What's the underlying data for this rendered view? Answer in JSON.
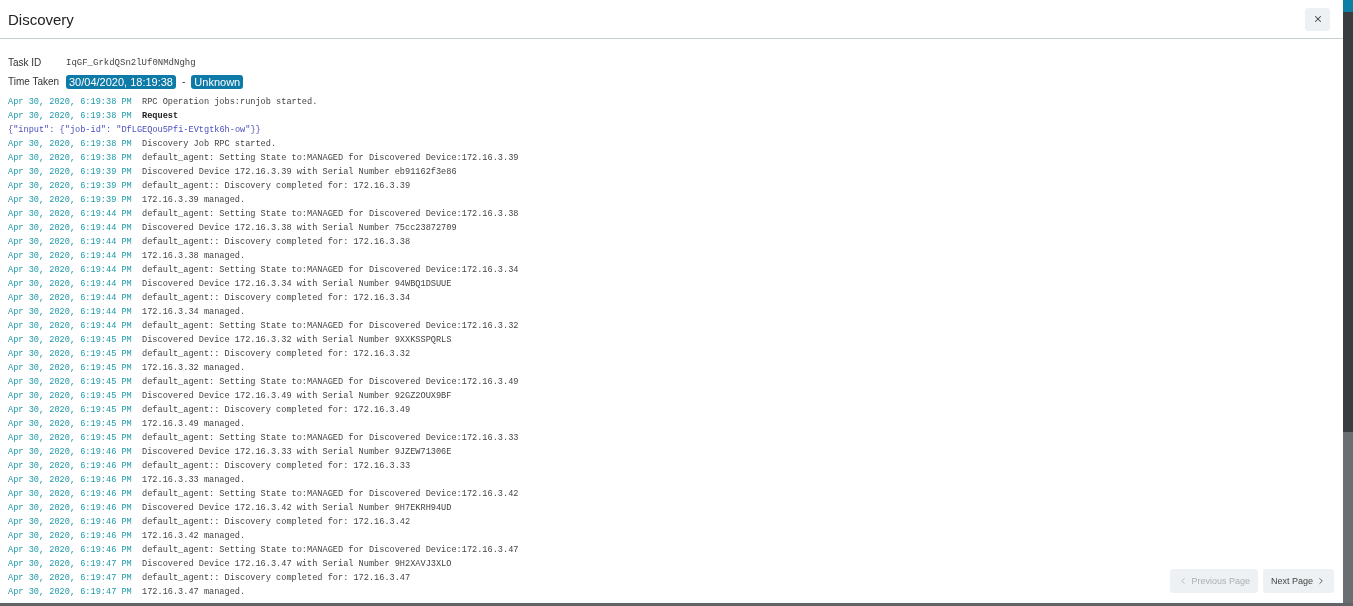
{
  "dialog": {
    "title": "Discovery"
  },
  "task": {
    "label": "Task ID",
    "value": "IqGF_GrkdQSn2lUf0NMdNghg"
  },
  "time_taken": {
    "label": "Time Taken",
    "start": "30/04/2020, 18:19:38",
    "separator": "-",
    "end": "Unknown"
  },
  "log": [
    {
      "kind": "entry",
      "time": "Apr 30, 2020, 6:19:38 PM",
      "message": "RPC Operation jobs:runjob started."
    },
    {
      "kind": "request",
      "time": "Apr 30, 2020, 6:19:38 PM",
      "message": "Request"
    },
    {
      "kind": "json",
      "message": "{\"input\": {\"job-id\": \"DfLGEQou5Pfi-EVtgtk6h-ow\"}}"
    },
    {
      "kind": "entry",
      "time": "Apr 30, 2020, 6:19:38 PM",
      "message": "Discovery Job RPC started."
    },
    {
      "kind": "entry",
      "time": "Apr 30, 2020, 6:19:38 PM",
      "message": "default_agent: Setting State to:MANAGED for Discovered Device:172.16.3.39"
    },
    {
      "kind": "entry",
      "time": "Apr 30, 2020, 6:19:39 PM",
      "message": "Discovered Device 172.16.3.39 with Serial Number eb91162f3e86"
    },
    {
      "kind": "entry",
      "time": "Apr 30, 2020, 6:19:39 PM",
      "message": "default_agent:: Discovery completed for: 172.16.3.39"
    },
    {
      "kind": "entry",
      "time": "Apr 30, 2020, 6:19:39 PM",
      "message": "172.16.3.39 managed."
    },
    {
      "kind": "entry",
      "time": "Apr 30, 2020, 6:19:44 PM",
      "message": "default_agent: Setting State to:MANAGED for Discovered Device:172.16.3.38"
    },
    {
      "kind": "entry",
      "time": "Apr 30, 2020, 6:19:44 PM",
      "message": "Discovered Device 172.16.3.38 with Serial Number 75cc23872709"
    },
    {
      "kind": "entry",
      "time": "Apr 30, 2020, 6:19:44 PM",
      "message": "default_agent:: Discovery completed for: 172.16.3.38"
    },
    {
      "kind": "entry",
      "time": "Apr 30, 2020, 6:19:44 PM",
      "message": "172.16.3.38 managed."
    },
    {
      "kind": "entry",
      "time": "Apr 30, 2020, 6:19:44 PM",
      "message": "default_agent: Setting State to:MANAGED for Discovered Device:172.16.3.34"
    },
    {
      "kind": "entry",
      "time": "Apr 30, 2020, 6:19:44 PM",
      "message": "Discovered Device 172.16.3.34 with Serial Number 94WBQ1DSUUE"
    },
    {
      "kind": "entry",
      "time": "Apr 30, 2020, 6:19:44 PM",
      "message": "default_agent:: Discovery completed for: 172.16.3.34"
    },
    {
      "kind": "entry",
      "time": "Apr 30, 2020, 6:19:44 PM",
      "message": "172.16.3.34 managed."
    },
    {
      "kind": "entry",
      "time": "Apr 30, 2020, 6:19:44 PM",
      "message": "default_agent: Setting State to:MANAGED for Discovered Device:172.16.3.32"
    },
    {
      "kind": "entry",
      "time": "Apr 30, 2020, 6:19:45 PM",
      "message": "Discovered Device 172.16.3.32 with Serial Number 9XXKSSPQRLS"
    },
    {
      "kind": "entry",
      "time": "Apr 30, 2020, 6:19:45 PM",
      "message": "default_agent:: Discovery completed for: 172.16.3.32"
    },
    {
      "kind": "entry",
      "time": "Apr 30, 2020, 6:19:45 PM",
      "message": "172.16.3.32 managed."
    },
    {
      "kind": "entry",
      "time": "Apr 30, 2020, 6:19:45 PM",
      "message": "default_agent: Setting State to:MANAGED for Discovered Device:172.16.3.49"
    },
    {
      "kind": "entry",
      "time": "Apr 30, 2020, 6:19:45 PM",
      "message": "Discovered Device 172.16.3.49 with Serial Number 92GZ2OUX9BF"
    },
    {
      "kind": "entry",
      "time": "Apr 30, 2020, 6:19:45 PM",
      "message": "default_agent:: Discovery completed for: 172.16.3.49"
    },
    {
      "kind": "entry",
      "time": "Apr 30, 2020, 6:19:45 PM",
      "message": "172.16.3.49 managed."
    },
    {
      "kind": "entry",
      "time": "Apr 30, 2020, 6:19:45 PM",
      "message": "default_agent: Setting State to:MANAGED for Discovered Device:172.16.3.33"
    },
    {
      "kind": "entry",
      "time": "Apr 30, 2020, 6:19:46 PM",
      "message": "Discovered Device 172.16.3.33 with Serial Number 9JZEW71306E"
    },
    {
      "kind": "entry",
      "time": "Apr 30, 2020, 6:19:46 PM",
      "message": "default_agent:: Discovery completed for: 172.16.3.33"
    },
    {
      "kind": "entry",
      "time": "Apr 30, 2020, 6:19:46 PM",
      "message": "172.16.3.33 managed."
    },
    {
      "kind": "entry",
      "time": "Apr 30, 2020, 6:19:46 PM",
      "message": "default_agent: Setting State to:MANAGED for Discovered Device:172.16.3.42"
    },
    {
      "kind": "entry",
      "time": "Apr 30, 2020, 6:19:46 PM",
      "message": "Discovered Device 172.16.3.42 with Serial Number 9H7EKRH94UD"
    },
    {
      "kind": "entry",
      "time": "Apr 30, 2020, 6:19:46 PM",
      "message": "default_agent:: Discovery completed for: 172.16.3.42"
    },
    {
      "kind": "entry",
      "time": "Apr 30, 2020, 6:19:46 PM",
      "message": "172.16.3.42 managed."
    },
    {
      "kind": "entry",
      "time": "Apr 30, 2020, 6:19:46 PM",
      "message": "default_agent: Setting State to:MANAGED for Discovered Device:172.16.3.47"
    },
    {
      "kind": "entry",
      "time": "Apr 30, 2020, 6:19:47 PM",
      "message": "Discovered Device 172.16.3.47 with Serial Number 9H2XAVJ3XLO"
    },
    {
      "kind": "entry",
      "time": "Apr 30, 2020, 6:19:47 PM",
      "message": "default_agent:: Discovery completed for: 172.16.3.47"
    },
    {
      "kind": "entry",
      "time": "Apr 30, 2020, 6:19:47 PM",
      "message": "172.16.3.47 managed."
    }
  ],
  "pagination": [
    {
      "kind": "previous",
      "label": "Previous Page",
      "disabled": true
    },
    {
      "kind": "next",
      "label": "Next Page",
      "disabled": false
    }
  ]
}
